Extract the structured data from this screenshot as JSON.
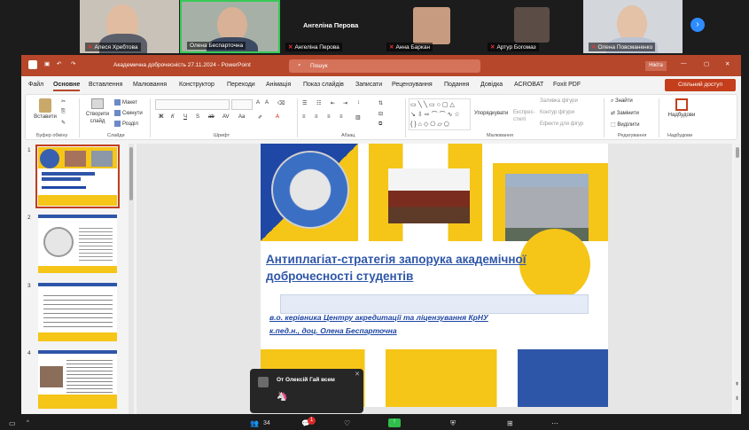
{
  "participants": [
    {
      "name": "Алеся Хребтова",
      "muted": true
    },
    {
      "name": "Олена Беспарточна",
      "muted": false
    },
    {
      "name": "Ангеліна Перова",
      "muted": true
    },
    {
      "name": "Анна Баркан",
      "muted": true
    },
    {
      "name": "Артур Богомаз",
      "muted": true
    },
    {
      "name": "Олена Повсманенко",
      "muted": true
    }
  ],
  "center_tile_name": "Ангеліна Перова",
  "ppt": {
    "title": "Академична доброчесність 27.11.2024 - PowerPoint",
    "search_placeholder": "Пошук",
    "user_badge": "Нікіта",
    "share_label": "Спільний доступ",
    "menu": [
      "Файл",
      "Основне",
      "Вставлення",
      "Малювання",
      "Конструктор",
      "Переходи",
      "Анімація",
      "Показ слайдів",
      "Записати",
      "Рецензування",
      "Подання",
      "Довідка",
      "ACROBAT",
      "Foxit PDF"
    ],
    "ribbon": {
      "paste": "Вставити",
      "create_slide": "Створити слайд",
      "layout": "Макет",
      "reset": "Скинути",
      "sections": "Розділ",
      "arrange": "Упорядкувати",
      "express_styles": "Експрес-стилі",
      "fill": "Заливка фігури",
      "outline": "Контур фігури",
      "effects": "Ефекти для фігур",
      "find": "Знайти",
      "replace": "Замінити",
      "select": "Виділити",
      "designer": "Надбудови",
      "groups": [
        "Буфер обміну",
        "Слайди",
        "Шрифт",
        "Абзац",
        "Малювання",
        "Редагування",
        "Надбудови"
      ]
    },
    "slide_numbers": [
      "1",
      "2",
      "3",
      "4"
    ],
    "slide": {
      "title": "Антиплагіат-стратегія запорука академічної доброчесності студентів",
      "subtitle_line1": "в.о. керівника Центру акредитації та ліцензування КрНУ",
      "subtitle_line2": "к.пед.н., доц. Олена Беспарточна"
    }
  },
  "chat_popup": {
    "from": "От Олексій Гай всем",
    "message": "🦄"
  },
  "bottombar": {
    "participants_count": "34",
    "chat_badge": "1"
  },
  "colors": {
    "ppt_accent": "#b7472a",
    "slide_yellow": "#f5c518",
    "slide_blue": "#1f47a5"
  }
}
